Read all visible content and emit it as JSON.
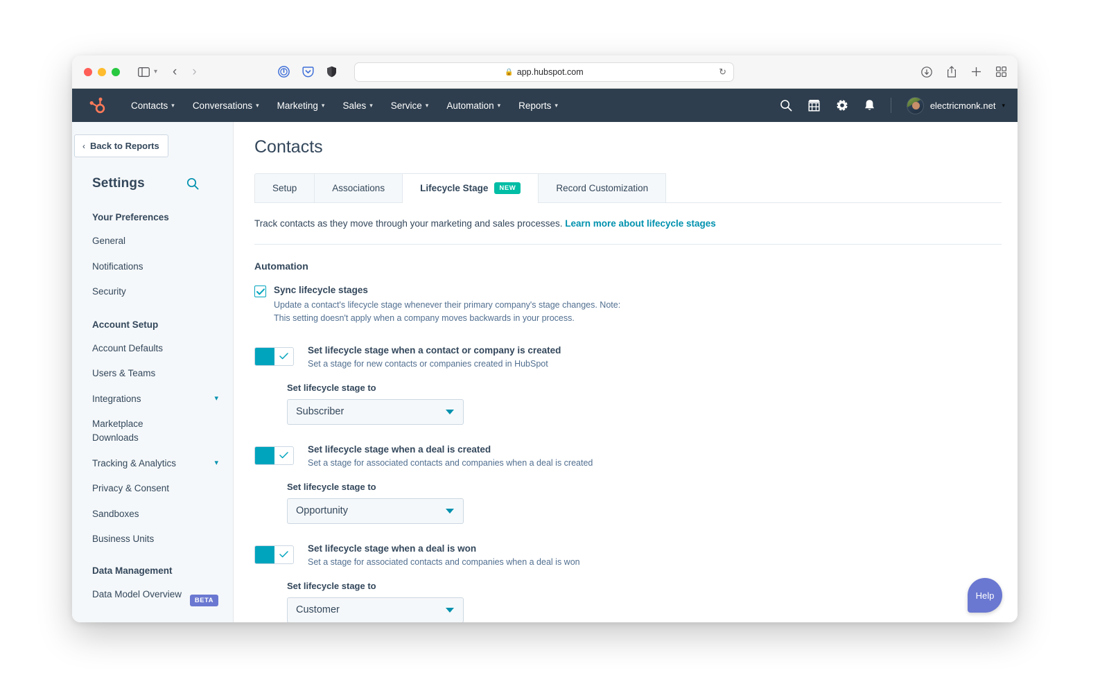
{
  "browser": {
    "url": "app.hubspot.com",
    "lock_icon": "lock-icon",
    "reload_icon": "reload-icon",
    "sidebar_icon": "sidebar-toggle-icon",
    "back_icon": "back-arrow-icon",
    "forward_icon": "forward-arrow-icon",
    "extensions": [
      "onepassword-extension-icon",
      "pocket-extension-icon",
      "privacy-shield-extension-icon"
    ],
    "right_icons": [
      "downloads-icon",
      "share-icon",
      "new-tab-icon",
      "tab-overview-icon"
    ]
  },
  "topnav": {
    "logo": "hubspot-logo",
    "items": [
      {
        "label": "Contacts"
      },
      {
        "label": "Conversations"
      },
      {
        "label": "Marketing"
      },
      {
        "label": "Sales"
      },
      {
        "label": "Service"
      },
      {
        "label": "Automation"
      },
      {
        "label": "Reports"
      }
    ],
    "icons": [
      "search-icon",
      "marketplace-icon",
      "gear-icon",
      "bell-icon"
    ],
    "user": "electricmonk.net"
  },
  "sidebar": {
    "back_label": "Back to Reports",
    "title": "Settings",
    "search_icon": "search-icon",
    "sections": [
      {
        "heading": "Your Preferences",
        "items": [
          {
            "label": "General",
            "expandable": false
          },
          {
            "label": "Notifications",
            "expandable": false
          },
          {
            "label": "Security",
            "expandable": false
          }
        ]
      },
      {
        "heading": "Account Setup",
        "items": [
          {
            "label": "Account Defaults",
            "expandable": false
          },
          {
            "label": "Users & Teams",
            "expandable": false
          },
          {
            "label": "Integrations",
            "expandable": true
          },
          {
            "label": "Marketplace Downloads",
            "expandable": false
          },
          {
            "label": "Tracking & Analytics",
            "expandable": true
          },
          {
            "label": "Privacy & Consent",
            "expandable": false
          },
          {
            "label": "Sandboxes",
            "expandable": false
          },
          {
            "label": "Business Units",
            "expandable": false
          }
        ]
      },
      {
        "heading": "Data Management",
        "items": [
          {
            "label": "Data Model Overview",
            "expandable": false,
            "badge": "BETA"
          }
        ]
      }
    ]
  },
  "main": {
    "page_title": "Contacts",
    "tabs": [
      {
        "label": "Setup",
        "active": false
      },
      {
        "label": "Associations",
        "active": false
      },
      {
        "label": "Lifecycle Stage",
        "active": true,
        "badge": "NEW"
      },
      {
        "label": "Record Customization",
        "active": false
      }
    ],
    "intro_text": "Track contacts as they move through your marketing and sales processes.",
    "intro_link": "Learn more about lifecycle stages",
    "section_title": "Automation",
    "sync_checkbox": {
      "checked": true,
      "label": "Sync lifecycle stages",
      "description": "Update a contact's lifecycle stage whenever their primary company's stage changes. Note: This setting doesn't apply when a company moves backwards in your process."
    },
    "toggle_rows": [
      {
        "enabled": true,
        "title": "Set lifecycle stage when a contact or company is created",
        "subtitle": "Set a stage for new contacts or companies created in HubSpot",
        "field_label": "Set lifecycle stage to",
        "selected_value": "Subscriber"
      },
      {
        "enabled": true,
        "title": "Set lifecycle stage when a deal is created",
        "subtitle": "Set a stage for associated contacts and companies when a deal is created",
        "field_label": "Set lifecycle stage to",
        "selected_value": "Opportunity"
      },
      {
        "enabled": true,
        "title": "Set lifecycle stage when a deal is won",
        "subtitle": "Set a stage for associated contacts and companies when a deal is won",
        "field_label": "Set lifecycle stage to",
        "selected_value": "Customer"
      }
    ],
    "help_label": "Help"
  },
  "colors": {
    "nav_bg": "#2e3e4e",
    "teal": "#00a4bd",
    "link": "#0091ae",
    "green_badge": "#00bda5",
    "purple_badge": "#6a78d1",
    "sidebar_bg": "#f5f8fa",
    "text": "#33475b"
  }
}
